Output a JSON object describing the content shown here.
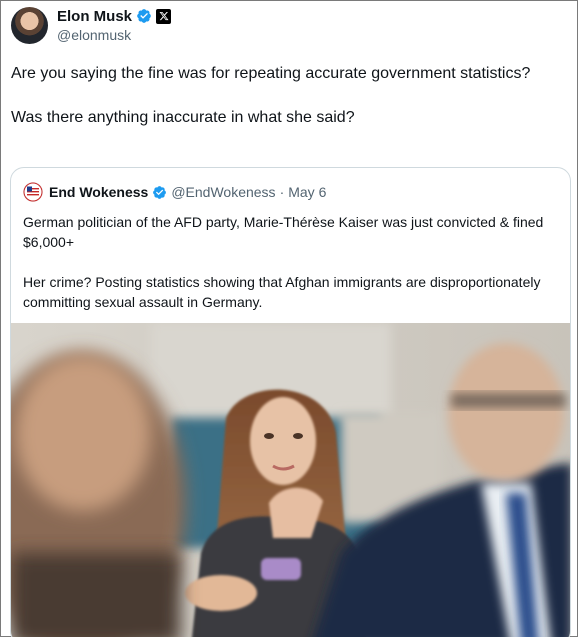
{
  "tweet": {
    "author_name": "Elon Musk",
    "author_handle": "@elonmusk",
    "text_paragraphs": [
      "Are you saying the fine was for repeating accurate government statistics?",
      "Was there anything inaccurate in what she said?"
    ]
  },
  "quoted_tweet": {
    "author_name": "End Wokeness",
    "author_handle": "@EndWokeness",
    "separator": "·",
    "date": "May 6",
    "text_paragraphs": [
      "German politician of the AFD party, Marie-Thérèse Kaiser was just convicted & fined $6,000+",
      "Her crime? Posting statistics showing that Afghan immigrants are disproportionately committing sexual assault in Germany."
    ]
  },
  "icons": {
    "verified": "verified-badge-icon",
    "platform": "x-logo-icon"
  },
  "colors": {
    "verified_blue": "#1d9bf0",
    "text_primary": "#0f1419",
    "text_secondary": "#536471",
    "border": "#cfd9de"
  }
}
